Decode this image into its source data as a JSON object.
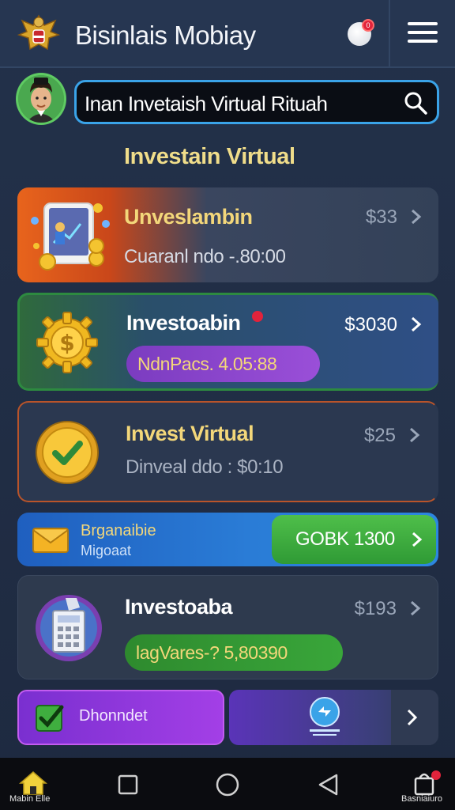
{
  "header": {
    "title": "Bisinlais Mobiay",
    "notification_count": "0",
    "logo_icon": "garuda-emblem-icon",
    "menu_icon": "hamburger-menu-icon"
  },
  "search": {
    "value": "Inan Invetaish Virtual Rituah",
    "icon": "search-icon"
  },
  "section_title": "Investain Virtual",
  "cards": [
    {
      "title": "Unveslambin",
      "price": "$33",
      "subtitle": "Cuaranl ndo -.80:00",
      "icon": "tablet-investment-icon"
    },
    {
      "title": "Investoabin",
      "price": "$3030",
      "pill": "NdnPacs. 4.05:88",
      "icon": "dollar-gear-coin-icon"
    },
    {
      "title": "Invest Virtual",
      "price": "$25",
      "subtitle": "Dinveal ddo : $0:10",
      "icon": "check-coin-icon"
    },
    {
      "title": "Investoaba",
      "price": "$193",
      "pill": "lagVares-? 5,80390",
      "icon": "calculator-icon"
    }
  ],
  "promo": {
    "title": "Brganaibie",
    "subtitle": "Migoaat",
    "cta_label": "GOBK 1300",
    "icon": "envelope-icon"
  },
  "bottom": {
    "left_label": "Dhonndet",
    "left_icon": "checkbox-icon",
    "right_icon": "badge-icon"
  },
  "navbar": {
    "left_label": "Mabin Elle",
    "right_label": "Basniaiuro",
    "items": [
      "home-icon",
      "square-icon",
      "circle-icon",
      "back-triangle-icon",
      "bag-icon"
    ]
  },
  "colors": {
    "accent_gold": "#f3d77a",
    "search_border": "#3aa3e8",
    "cta_green": "#3fae3f",
    "pill_purple": "#8a45cc",
    "notif_red": "#e2233b"
  }
}
